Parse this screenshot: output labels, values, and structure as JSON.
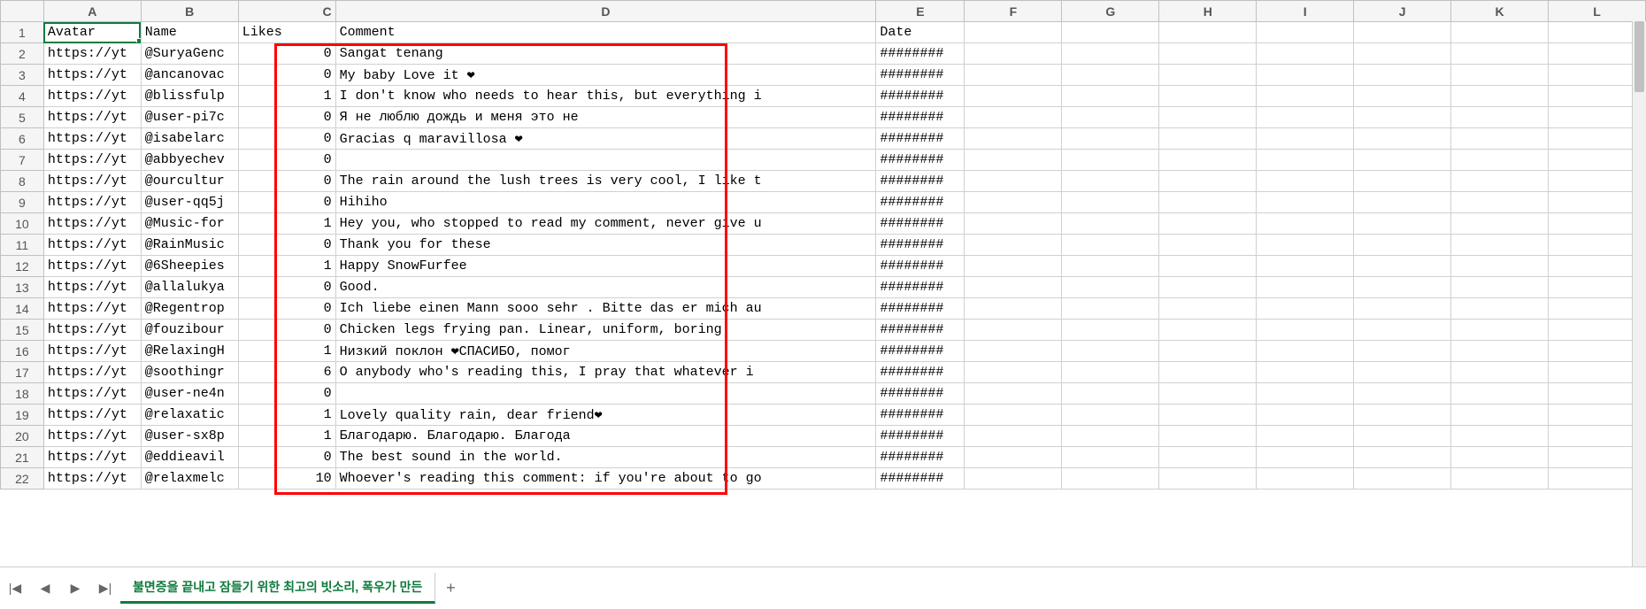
{
  "columns": [
    "A",
    "B",
    "C",
    "D",
    "E",
    "F",
    "G",
    "H",
    "I",
    "J",
    "K",
    "L"
  ],
  "headers": {
    "avatar": "Avatar",
    "name": "Name",
    "likes": "Likes",
    "comment": "Comment",
    "date": "Date"
  },
  "sheet_tab": "불면증을 끝내고 잠들기 위한 최고의 빗소리, 폭우가 만든",
  "selected_cell": "A1",
  "rows": [
    {
      "avatar": "https://yt",
      "name": "@SuryaGenc",
      "likes": 0,
      "comment": "Sangat tenang",
      "date": "########"
    },
    {
      "avatar": "https://yt",
      "name": "@ancanovac",
      "likes": 0,
      "comment": "My baby Love it ❤",
      "date": "########"
    },
    {
      "avatar": "https://yt",
      "name": "@blissfulp",
      "likes": 1,
      "comment": "I don't know who needs to hear this, but everything i",
      "date": "########"
    },
    {
      "avatar": "https://yt",
      "name": "@user-pi7c",
      "likes": 0,
      "comment": "Я не люблю дождь и меня это не",
      "date": "########"
    },
    {
      "avatar": "https://yt",
      "name": "@isabelarc",
      "likes": 0,
      "comment": "Gracias q maravillosa ❤",
      "date": "########"
    },
    {
      "avatar": "https://yt",
      "name": "@abbyechev",
      "likes": 0,
      "comment": "",
      "date": "########"
    },
    {
      "avatar": "https://yt",
      "name": "@ourcultur",
      "likes": 0,
      "comment": "The rain around the lush trees is very cool, I like t",
      "date": "########"
    },
    {
      "avatar": "https://yt",
      "name": "@user-qq5j",
      "likes": 0,
      "comment": "Hihiho",
      "date": "########"
    },
    {
      "avatar": "https://yt",
      "name": "@Music-for",
      "likes": 1,
      "comment": "Hey you, who stopped to read my comment, never give u",
      "date": "########"
    },
    {
      "avatar": "https://yt",
      "name": "@RainMusic",
      "likes": 0,
      "comment": "Thank you for these",
      "date": "########"
    },
    {
      "avatar": "https://yt",
      "name": "@6Sheepies",
      "likes": 1,
      "comment": "Happy SnowFurfee",
      "date": "########"
    },
    {
      "avatar": "https://yt",
      "name": "@allalukya",
      "likes": 0,
      "comment": "Good.",
      "date": "########"
    },
    {
      "avatar": "https://yt",
      "name": "@Regentrop",
      "likes": 0,
      "comment": "Ich liebe einen Mann sooo sehr . Bitte das er mich au",
      "date": "########"
    },
    {
      "avatar": "https://yt",
      "name": "@fouzibour",
      "likes": 0,
      "comment": "Chicken legs frying pan. Linear,  uniform, boring",
      "date": "########"
    },
    {
      "avatar": "https://yt",
      "name": "@RelaxingH",
      "likes": 1,
      "comment": "Низкий поклон ❤СПАСИБО, помог",
      "date": "########"
    },
    {
      "avatar": "https://yt",
      "name": "@soothingr",
      "likes": 6,
      "comment": "O anybody who's reading this, I pray that whatever i",
      "date": "########"
    },
    {
      "avatar": "https://yt",
      "name": "@user-ne4n",
      "likes": 0,
      "comment": "",
      "date": "########"
    },
    {
      "avatar": "https://yt",
      "name": "@relaxatic",
      "likes": 1,
      "comment": "Lovely quality rain, dear friend❤",
      "date": "########"
    },
    {
      "avatar": "https://yt",
      "name": "@user-sx8p",
      "likes": 1,
      "comment": "Благодарю. Благодарю. Благода",
      "date": "########"
    },
    {
      "avatar": "https://yt",
      "name": "@eddieavil",
      "likes": 0,
      "comment": "The best sound in the world.",
      "date": "########"
    },
    {
      "avatar": "https://yt",
      "name": "@relaxmelc",
      "likes": 10,
      "comment": "Whoever's reading this comment: if you're about to go",
      "date": "########"
    }
  ]
}
